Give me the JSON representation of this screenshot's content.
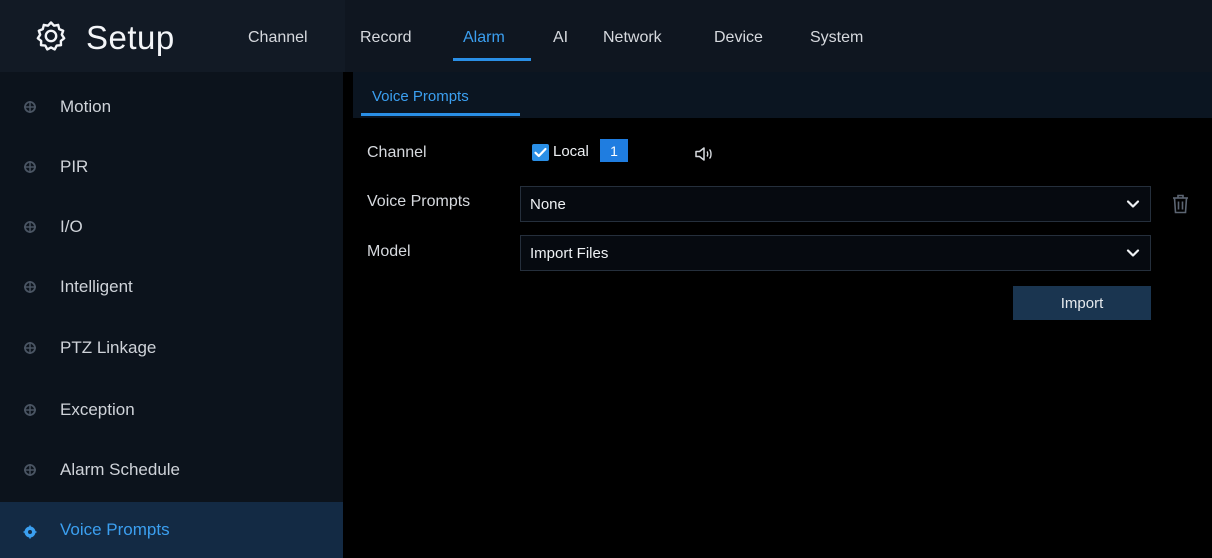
{
  "header": {
    "title": "Setup",
    "icon": "gear-icon",
    "tabs": [
      {
        "label": "Channel"
      },
      {
        "label": "Record"
      },
      {
        "label": "Alarm",
        "active": true
      },
      {
        "label": "AI"
      },
      {
        "label": "Network"
      },
      {
        "label": "Device"
      },
      {
        "label": "System"
      }
    ]
  },
  "sidebar": {
    "items": [
      {
        "label": "Motion"
      },
      {
        "label": "PIR"
      },
      {
        "label": "I/O"
      },
      {
        "label": "Intelligent"
      },
      {
        "label": "PTZ Linkage"
      },
      {
        "label": "Exception"
      },
      {
        "label": "Alarm Schedule"
      },
      {
        "label": "Voice Prompts",
        "active": true
      }
    ]
  },
  "main": {
    "subtab": "Voice Prompts",
    "form": {
      "channel_label": "Channel",
      "local_label": "Local",
      "channel_number": "1",
      "voice_prompts_label": "Voice Prompts",
      "voice_prompts_value": "None",
      "model_label": "Model",
      "model_value": "Import Files",
      "import_button": "Import"
    }
  },
  "colors": {
    "accent": "#2a8fe6",
    "active_text": "#3b9ff0",
    "background": "#000000",
    "sidebar_active": "#132a44"
  }
}
